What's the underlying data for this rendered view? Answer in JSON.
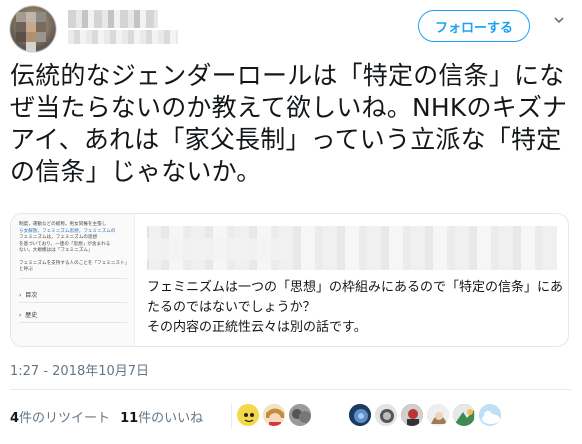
{
  "follow_button": "フォローする",
  "tweet_text": "伝統的なジェンダーロールは「特定の信条」になぜ当たらないのか教えて欲しいね。NHKのキズナアイ、あれは「家父長制」っていう立派な「特定の信条」じゃないか。",
  "card": {
    "thumbnail_lines": [
      "制度，運動などの総称。男女同権を主張し",
      "ら女解放，フェミニズム思想，フェミニズムの",
      "フェミニズムは，フェミニズムの思想",
      "を基づいており，一連の「思想」が含まれる",
      "ない。大規模はは「フェミニズム」"
    ],
    "thumbnail_subtext": "フェミニズムを支持する人のことを「フェミニスト」と呼ぶ",
    "thumbnail_menu": [
      "目次",
      "歴史"
    ],
    "text": "フェミニズムは一つの「思想」の枠組みにあるので「特定の信条」にあたるのではないでしょうか？\nその内容の正統性云々は別の話です。"
  },
  "timestamp": "1:27 - 2018年10月7日",
  "stats": {
    "retweets_count": "4",
    "retweets_label": "件のリツイート",
    "likes_count": "11",
    "likes_label": "件のいいね"
  },
  "colors": {
    "accent": "#1da1f2",
    "muted": "#657786",
    "border": "#e1e8ed"
  },
  "icons": {
    "caret": "chevron-down-icon"
  }
}
